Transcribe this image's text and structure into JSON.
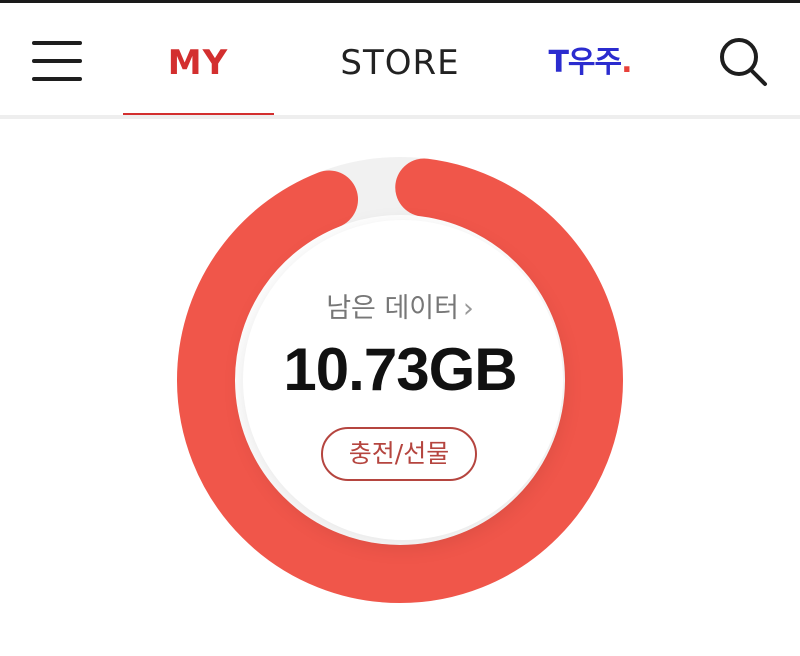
{
  "header": {
    "tabs": [
      {
        "label": "MY",
        "active": true
      },
      {
        "label": "STORE",
        "active": false
      },
      {
        "label": "T우주",
        "active": false
      }
    ],
    "brand_dot": ".",
    "menu_icon": "hamburger-menu-icon",
    "search_icon": "search-icon"
  },
  "usage": {
    "label": "남은 데이터",
    "chevron": "›",
    "remaining": "10.73GB",
    "remaining_fraction": 0.92,
    "charge_button": "충전/선물"
  },
  "colors": {
    "accent": "#d32f2f",
    "ring": "#f0564a",
    "ring_track": "#f1f1f1",
    "tuniverse": "#2b2ccf"
  }
}
